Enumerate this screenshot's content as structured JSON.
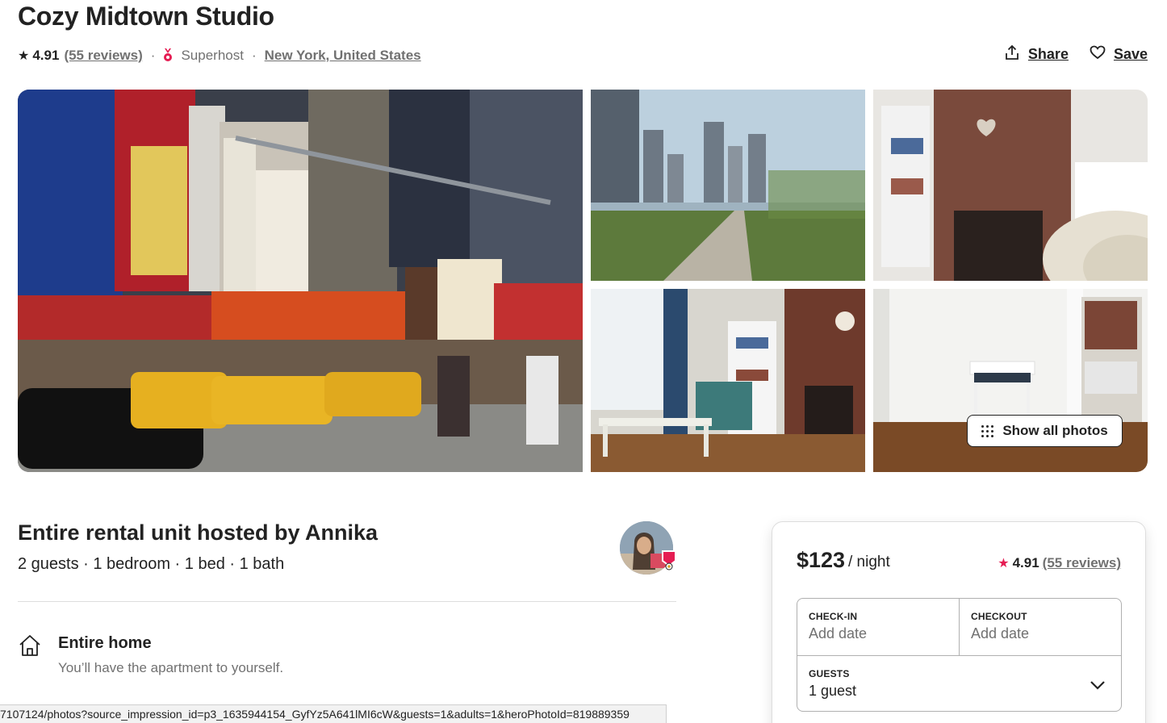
{
  "listing": {
    "title": "Cozy Midtown Studio",
    "rating": "4.91",
    "reviews_link": "(55 reviews)",
    "separator": "·",
    "superhost": "Superhost",
    "location": "New York, United States"
  },
  "actions": {
    "share": "Share",
    "save": "Save"
  },
  "gallery": {
    "show_all_label": "Show all photos"
  },
  "overview": {
    "hosted_by": "Entire rental unit hosted by Annika",
    "facts": "2 guests · 1 bedroom · 1 bed · 1 bath"
  },
  "highlights": [
    {
      "icon": "home-icon",
      "title": "Entire home",
      "description": "You’ll have the apartment to yourself."
    }
  ],
  "booking": {
    "price": "$123",
    "per": "/ night",
    "rating": "4.91",
    "reviews_link": "(55 reviews)",
    "checkin_label": "CHECK-IN",
    "checkin_value": "Add date",
    "checkout_label": "CHECKOUT",
    "checkout_value": "Add date",
    "guests_label": "GUESTS",
    "guests_value": "1 guest"
  },
  "status_bar": "7107124/photos?source_impression_id=p3_1635944154_GyfYz5A641lMI6cW&guests=1&adults=1&heroPhotoId=819889359",
  "colors": {
    "brand": "#e51d53",
    "text": "#222222",
    "muted": "#717171",
    "border": "#dddddd"
  }
}
